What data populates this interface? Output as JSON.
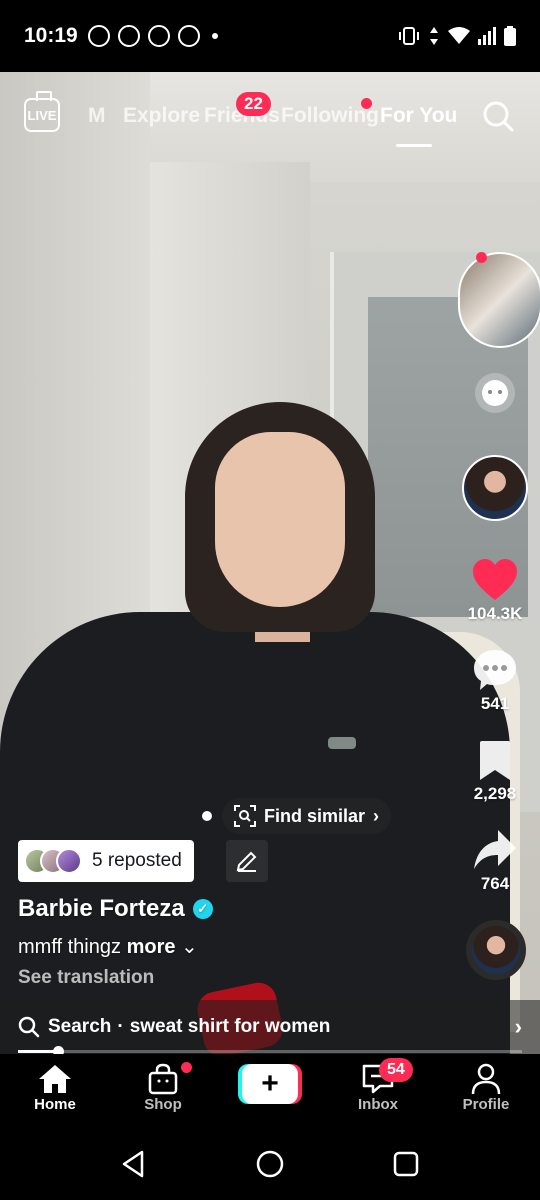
{
  "status_bar": {
    "time": "10:19"
  },
  "top_nav": {
    "tabs": [
      {
        "label": "M"
      },
      {
        "label": "Explore"
      },
      {
        "label": "Friends",
        "badge": "22"
      },
      {
        "label": "Following"
      },
      {
        "label": "For You"
      }
    ],
    "active_tab": "For You"
  },
  "rail": {
    "likes": "104.3K",
    "comments": "541",
    "saves": "2,298",
    "shares": "764"
  },
  "overlay": {
    "find_similar": "Find similar",
    "reposted": "5 reposted",
    "username": "Barbie Forteza",
    "caption": "mmff thingz",
    "more": "more",
    "see_translation": "See translation",
    "search_prefix": "Search",
    "search_query": "sweat shirt for women",
    "progress": 0.08
  },
  "tabbar": {
    "home": "Home",
    "shop": "Shop",
    "inbox": "Inbox",
    "inbox_badge": "54",
    "profile": "Profile"
  },
  "colors": {
    "accent": "#fe2c55",
    "verified": "#20d5ec"
  }
}
